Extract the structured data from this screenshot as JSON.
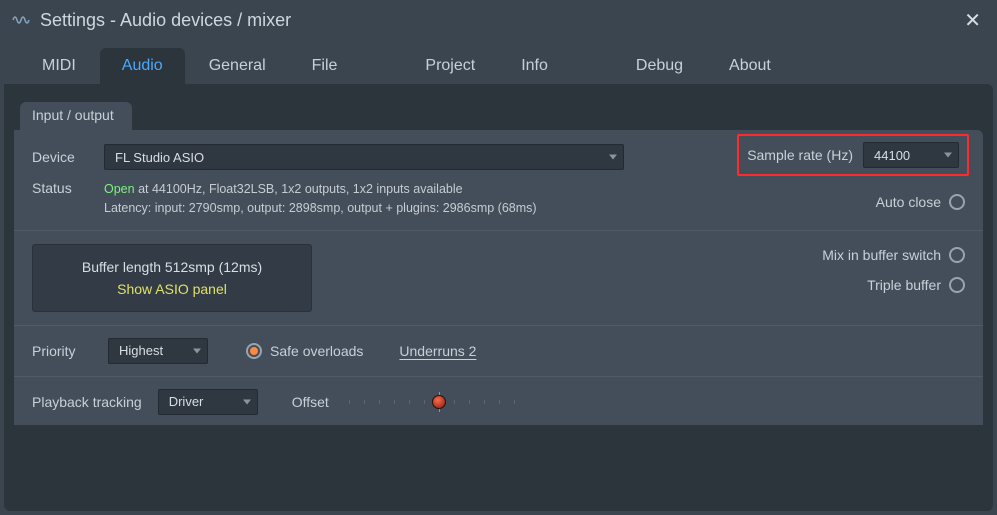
{
  "window": {
    "title": "Settings - Audio devices / mixer"
  },
  "tabs": {
    "midi": "MIDI",
    "audio": "Audio",
    "general": "General",
    "file": "File",
    "project": "Project",
    "info": "Info",
    "debug": "Debug",
    "about": "About"
  },
  "group": {
    "io_label": "Input / output"
  },
  "device": {
    "label": "Device",
    "value": "FL Studio ASIO"
  },
  "sample_rate": {
    "label": "Sample rate (Hz)",
    "value": "44100"
  },
  "status": {
    "label": "Status",
    "open_word": "Open",
    "line1_rest": " at 44100Hz, Float32LSB, 1x2 outputs, 1x2 inputs available",
    "line2": "Latency: input: 2790smp, output: 2898smp, output + plugins: 2986smp (68ms)"
  },
  "auto_close": {
    "label": "Auto close",
    "on": false
  },
  "buffer": {
    "length_line": "Buffer length 512smp (12ms)",
    "asio_link": "Show ASIO panel"
  },
  "mix_in_buffer": {
    "label": "Mix in buffer switch",
    "on": false
  },
  "triple_buffer": {
    "label": "Triple buffer",
    "on": false
  },
  "priority": {
    "label": "Priority",
    "value": "Highest"
  },
  "safe_overloads": {
    "label": "Safe overloads",
    "on": true
  },
  "underruns": {
    "label": "Underruns 2"
  },
  "playback_tracking": {
    "label": "Playback tracking",
    "value": "Driver"
  },
  "offset": {
    "label": "Offset"
  }
}
